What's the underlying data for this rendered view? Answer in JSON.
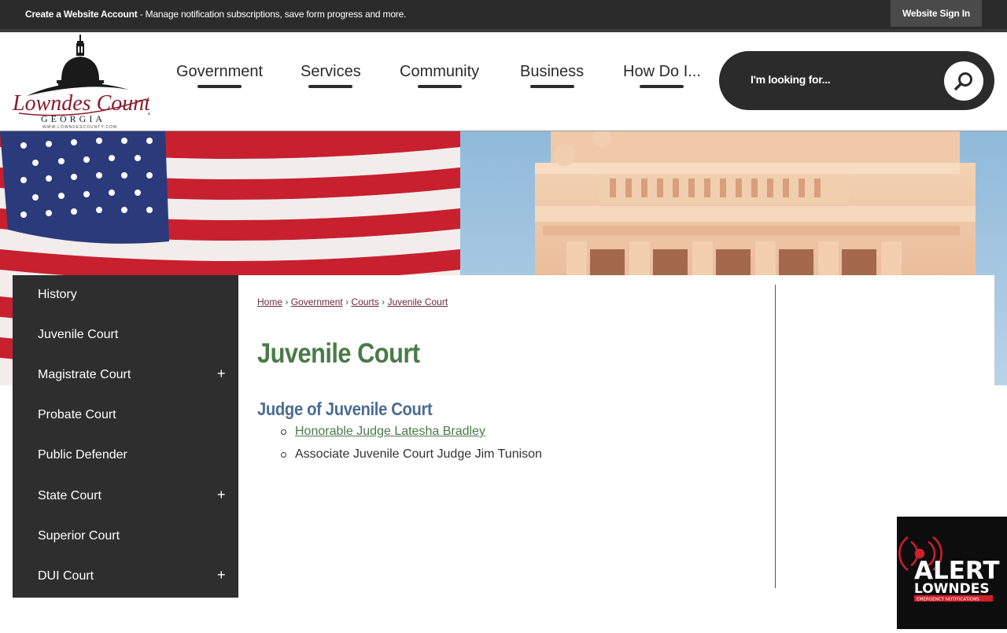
{
  "topbar": {
    "create_account": "Create a Website Account",
    "create_account_desc": " - Manage notification subscriptions, save form progress and more.",
    "sign_in": "Website Sign In"
  },
  "logo": {
    "name": "Lowndes County",
    "state": "GEORGIA",
    "url": "WWW.LOWNDESCOUNTY.COM"
  },
  "nav": {
    "items": [
      "Government",
      "Services",
      "Community",
      "Business",
      "How Do I..."
    ]
  },
  "search": {
    "placeholder": "I'm looking for..."
  },
  "sidebar": {
    "items": [
      {
        "label": "History",
        "expandable": false
      },
      {
        "label": "Juvenile Court",
        "expandable": false
      },
      {
        "label": "Magistrate Court",
        "expandable": true
      },
      {
        "label": "Probate Court",
        "expandable": false
      },
      {
        "label": "Public Defender",
        "expandable": false
      },
      {
        "label": "State Court",
        "expandable": true
      },
      {
        "label": "Superior Court",
        "expandable": false
      },
      {
        "label": "DUI Court",
        "expandable": true
      }
    ],
    "plus": "+"
  },
  "breadcrumb": {
    "items": [
      "Home",
      "Government",
      "Courts",
      "Juvenile Court"
    ],
    "separator": "›"
  },
  "main": {
    "title": "Juvenile Court",
    "section_title": "Judge of Juvenile Court",
    "judges": [
      {
        "text": "Honorable Judge Latesha Bradley",
        "link": true
      },
      {
        "text": "Associate Juvenile Court Judge Jim Tunison",
        "link": false
      }
    ]
  },
  "alert": {
    "line1": "ALERT",
    "line2": "LOWNDES",
    "line3": "EMERGENCY NOTIFICATIONS"
  },
  "colors": {
    "dark": "#2b2b2b",
    "title_green": "#4a7a48",
    "section_blue": "#4b6c93",
    "link_maroon": "#6b2b3a",
    "alert_red": "#d0202a"
  }
}
